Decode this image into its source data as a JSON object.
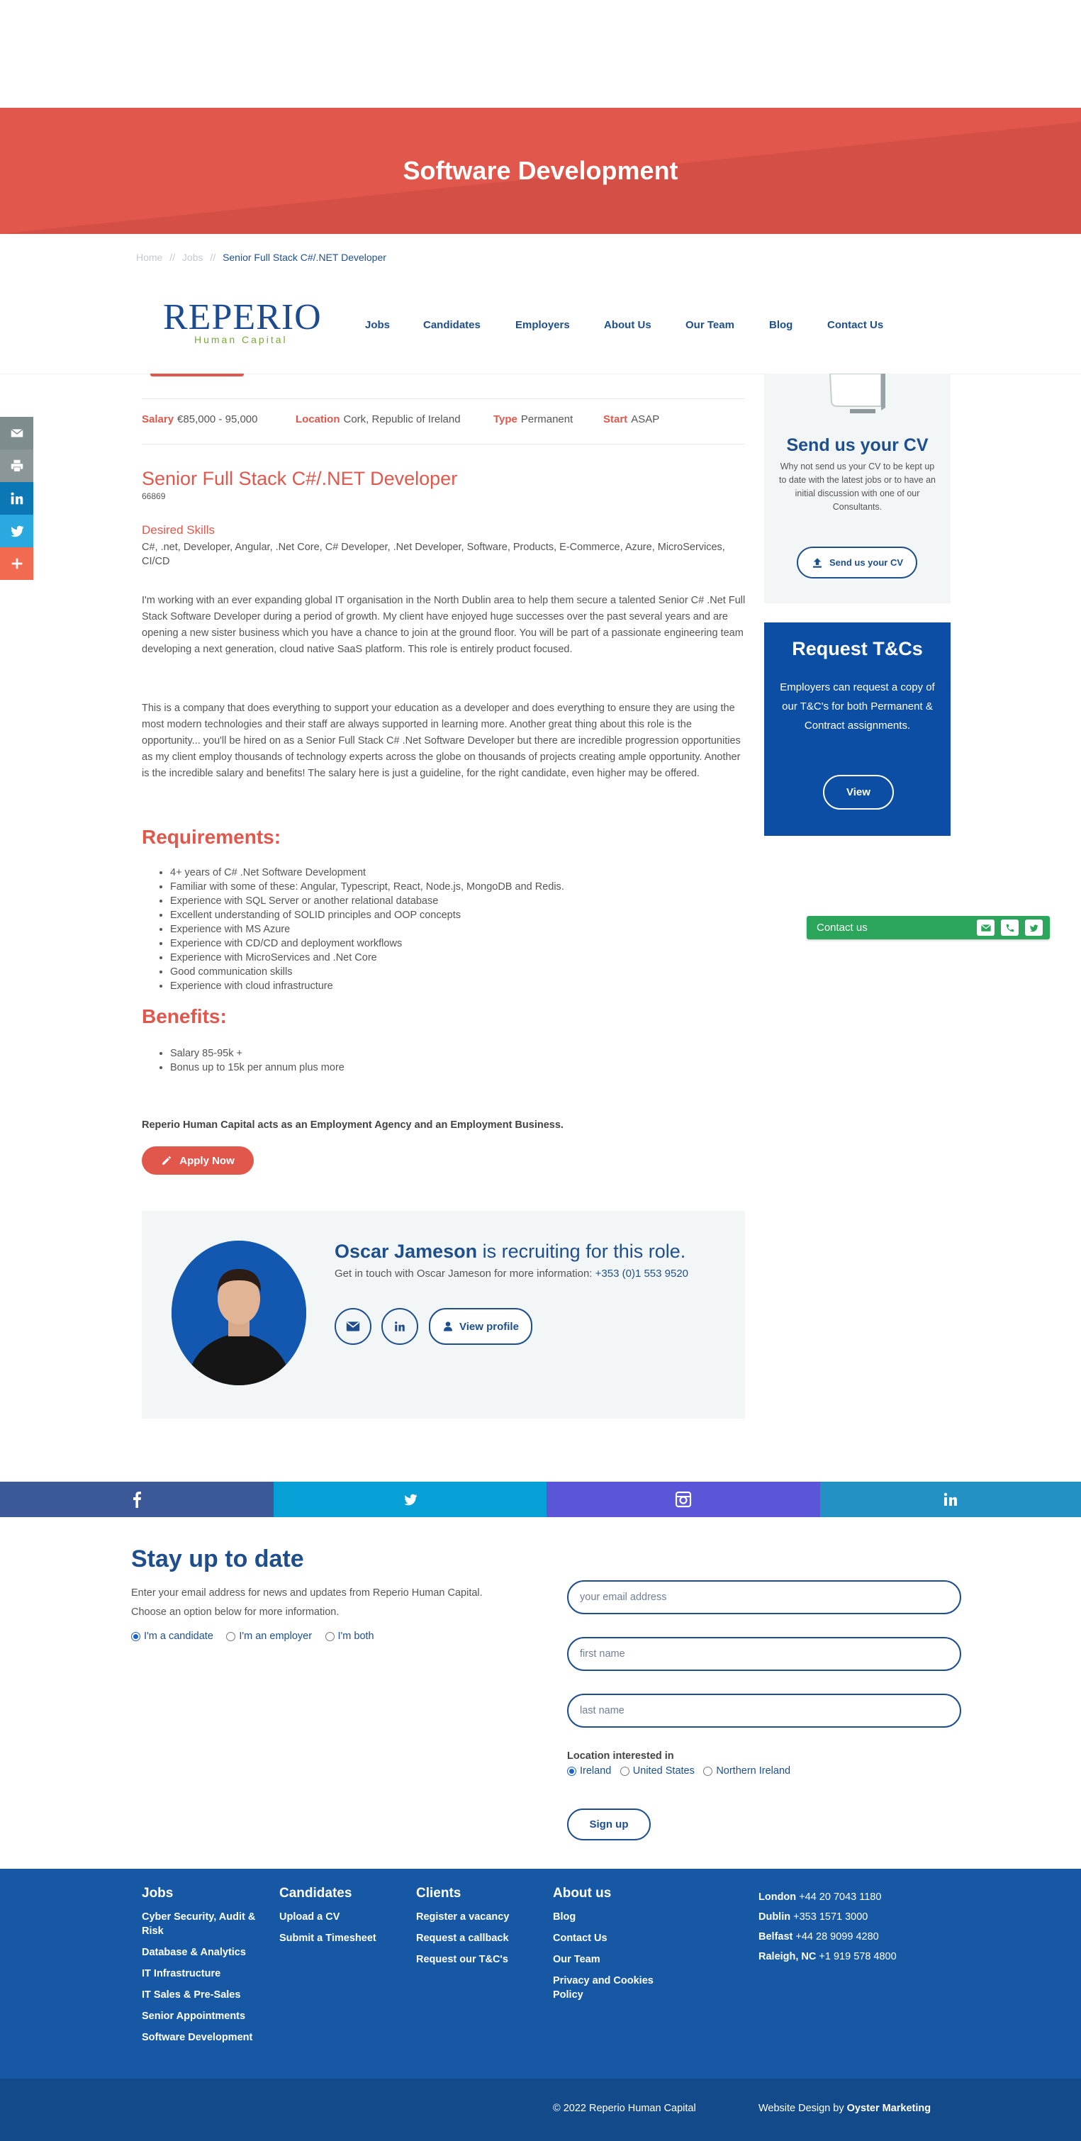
{
  "banner": {
    "title": "Software Development",
    "color": "#e2574c"
  },
  "breadcrumb": {
    "home": "Home",
    "sep": "//",
    "jobs": "Jobs",
    "current": "Senior Full Stack C#/.NET Developer"
  },
  "logo": {
    "name": "REPERIO",
    "tagline": "Human Capital"
  },
  "nav": [
    "Jobs",
    "Candidates",
    "Employers",
    "About Us",
    "Our Team",
    "Blog",
    "Contact Us"
  ],
  "share": [
    {
      "icon": "email-icon",
      "color": "#7e8c8e"
    },
    {
      "icon": "print-icon",
      "color": "#8a9698"
    },
    {
      "icon": "linkedin-icon",
      "color": "#0b78b5"
    },
    {
      "icon": "twitter-icon",
      "color": "#2aa9e0"
    },
    {
      "icon": "plus-icon",
      "color": "#f26b50"
    }
  ],
  "job": {
    "salary_label": "Salary",
    "salary": "€85,000 - 95,000",
    "location_label": "Location",
    "location": "Cork, Republic of Ireland",
    "type_label": "Type",
    "type": "Permanent",
    "start_label": "Start",
    "start": "ASAP",
    "title": "Senior Full Stack C#/.NET Developer",
    "ref": "66869",
    "skills_label": "Desired Skills",
    "skills": "C#, .net, Developer, Angular, .Net Core, C# Developer, .Net Developer, Software, Products, E-Commerce, Azure, MicroServices, CI/CD",
    "para1": "I'm working with an ever expanding global IT organisation in the North Dublin area to help them secure a talented Senior C# .Net Full Stack Software Developer during a period of growth. My client have enjoyed huge successes over the past several years and are opening a new sister business which you have a chance to join at the ground floor. You will be part of a passionate engineering team developing a next generation, cloud native SaaS platform. This role is entirely product focused.",
    "para2": "This is a company that does everything to support your education as a developer and does everything to ensure they are using the most modern technologies and their staff are always supported in learning more. Another great thing about this role is the opportunity... you'll be hired on as a Senior Full Stack C# .Net Software Developer but there are incredible progression opportunities as my client employ thousands of technology experts across the globe on thousands of projects creating ample opportunity. Another is the incredible salary and benefits! The salary here is just a guideline, for the right candidate, even higher may be offered.",
    "requirements_title": "Requirements:",
    "requirements": [
      "4+ years of C# .Net Software Development",
      "Familiar with some of these: Angular, Typescript, React, Node.js, MongoDB and Redis.",
      "Experience with SQL Server or another relational database",
      "Excellent understanding of SOLID principles and OOP concepts",
      "Experience with MS Azure",
      "Experience with CD/CD and deployment workflows",
      "Experience with MicroServices and .Net Core",
      "Good communication skills",
      "Experience with cloud infrastructure"
    ],
    "benefits_title": "Benefits:",
    "benefits": [
      "Salary 85-95k +",
      "Bonus up to 15k per annum plus more"
    ],
    "agency_note": "Reperio Human Capital acts as an Employment Agency and an Employment Business.",
    "apply_label": "Apply Now"
  },
  "sidebar": {
    "cv_title": "Send us your CV",
    "cv_text": "Why not send us your CV to be kept up to date with the latest jobs or to have an initial discussion with one of our Consultants.",
    "cv_button": "Send us your CV",
    "tc_title": "Request T&Cs",
    "tc_text": "Employers can request a copy of our T&C's for both Permanent & Contract assignments.",
    "tc_button": "View",
    "contact_label": "Contact us"
  },
  "recruiter": {
    "name": "Oscar Jameson",
    "headline_suffix": "is recruiting for this role.",
    "get_in_touch": "Get in touch with Oscar Jameson for more information:",
    "phone": "+353 (0)1 553 9520",
    "profile_button": "View profile"
  },
  "social": [
    {
      "icon": "facebook-icon",
      "color": "#3b5998"
    },
    {
      "icon": "twitter-icon",
      "color": "#069fd6"
    },
    {
      "icon": "instagram-icon",
      "color": "#5b55d8"
    },
    {
      "icon": "linkedin-icon",
      "color": "#2391c3"
    }
  ],
  "newsletter": {
    "title": "Stay up to date",
    "text1": "Enter your email address for news and updates from Reperio Human Capital.",
    "text2": "Choose an option below for more information.",
    "options": [
      "I'm a candidate",
      "I'm an employer",
      "I'm both"
    ],
    "selected_option": "I'm a candidate",
    "email_placeholder": "your email address",
    "first_placeholder": "first name",
    "last_placeholder": "last name",
    "location_label": "Location interested in",
    "locations": [
      "Ireland",
      "United States",
      "Northern Ireland"
    ],
    "selected_location": "Ireland",
    "signup": "Sign up"
  },
  "footer": {
    "jobs_title": "Jobs",
    "jobs": [
      "Cyber Security, Audit & Risk",
      "Database & Analytics",
      "IT Infrastructure",
      "IT Sales & Pre-Sales",
      "Senior Appointments",
      "Software Development"
    ],
    "candidates_title": "Candidates",
    "candidates": [
      "Upload a CV",
      "Submit a Timesheet"
    ],
    "clients_title": "Clients",
    "clients": [
      "Register a vacancy",
      "Request a callback",
      "Request our T&C's"
    ],
    "about_title": "About us",
    "about": [
      "Blog",
      "Contact Us",
      "Our Team",
      "Privacy and Cookies Policy"
    ],
    "offices": [
      {
        "city": "London",
        "phone": "+44 20 7043 1180"
      },
      {
        "city": "Dublin",
        "phone": "+353 1571 3000"
      },
      {
        "city": "Belfast",
        "phone": "+44 28 9099 4280"
      },
      {
        "city": "Raleigh, NC",
        "phone": "+1 919 578 4800"
      }
    ],
    "copyright": "© 2022 Reperio Human Capital",
    "design_prefix": "Website Design by",
    "design_by": "Oyster Marketing"
  }
}
